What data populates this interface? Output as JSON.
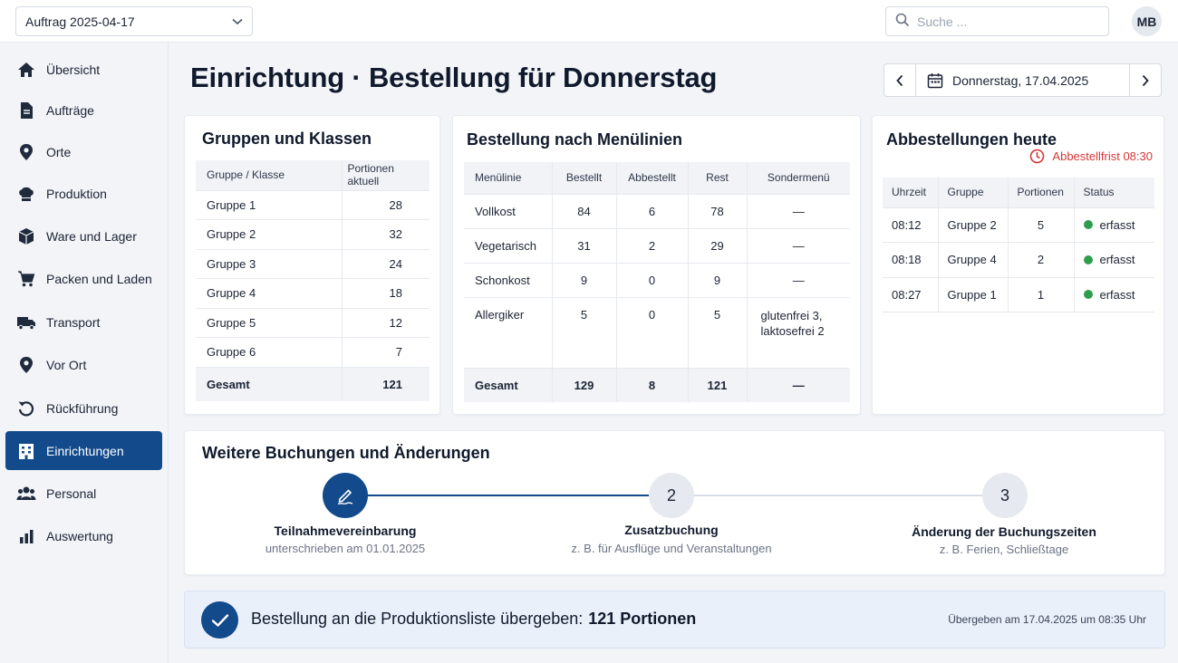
{
  "topbar": {
    "order_select_value": "Auftrag 2025-04-17",
    "search_placeholder": "Suche ...",
    "avatar_initials": "MB"
  },
  "sidebar": {
    "items": [
      {
        "label": "Übersicht",
        "icon": "home-icon"
      },
      {
        "label": "Aufträge",
        "icon": "document-icon"
      },
      {
        "label": "Orte",
        "icon": "location-pin-icon"
      },
      {
        "label": "Produktion",
        "icon": "chef-hat-icon"
      },
      {
        "label": "Ware und Lager",
        "icon": "box-icon"
      },
      {
        "label": "Packen und Laden",
        "icon": "cart-icon"
      },
      {
        "label": "Transport",
        "icon": "truck-icon"
      },
      {
        "label": "Vor Ort",
        "icon": "location-pin-icon"
      },
      {
        "label": "Rückführung",
        "icon": "return-arrow-icon"
      },
      {
        "label": "Einrichtungen",
        "icon": "building-icon",
        "active": true
      },
      {
        "label": "Personal",
        "icon": "people-icon"
      },
      {
        "label": "Auswertung",
        "icon": "bar-chart-icon"
      }
    ]
  },
  "header": {
    "title": "Einrichtung · Bestellung für Donnerstag",
    "date": "Donnerstag, 17.04.2025"
  },
  "groups": {
    "title": "Gruppen und Klassen",
    "columns": [
      "Gruppe / Klasse",
      "Portionen aktuell"
    ],
    "rows": [
      {
        "name": "Gruppe 1",
        "portions": "28"
      },
      {
        "name": "Gruppe 2",
        "portions": "32"
      },
      {
        "name": "Gruppe 3",
        "portions": "24"
      },
      {
        "name": "Gruppe 4",
        "portions": "18"
      },
      {
        "name": "Gruppe 5",
        "portions": "12"
      },
      {
        "name": "Gruppe 6",
        "portions": "7"
      }
    ],
    "total": {
      "label": "Gesamt",
      "portions": "121"
    }
  },
  "menu": {
    "title": "Bestellung nach Menülinien",
    "columns": [
      "Menülinie",
      "Bestellt",
      "Abbestellt",
      "Rest",
      "Sondermenü"
    ],
    "rows": [
      {
        "line": "Vollkost",
        "ordered": "84",
        "cancelled": "6",
        "rest": "78",
        "special": "—"
      },
      {
        "line": "Vegetarisch",
        "ordered": "31",
        "cancelled": "2",
        "rest": "29",
        "special": "—"
      },
      {
        "line": "Schonkost",
        "ordered": "9",
        "cancelled": "0",
        "rest": "9",
        "special": "—"
      },
      {
        "line": "Allergiker",
        "ordered": "5",
        "cancelled": "0",
        "rest": "5",
        "special_line1": "glutenfrei 3,",
        "special_line2": "laktosefrei 2"
      }
    ],
    "total": {
      "label": "Gesamt",
      "ordered": "129",
      "cancelled": "8",
      "rest": "121",
      "special": "—"
    }
  },
  "cancellations": {
    "title": "Abbestellungen heute",
    "deadline": "Abbestellfrist 08:30",
    "columns": [
      "Uhrzeit",
      "Gruppe",
      "Portionen",
      "Status"
    ],
    "rows": [
      {
        "time": "08:12",
        "group": "Gruppe 2",
        "portions": "5",
        "status": "erfasst"
      },
      {
        "time": "08:18",
        "group": "Gruppe 4",
        "portions": "2",
        "status": "erfasst"
      },
      {
        "time": "08:27",
        "group": "Gruppe 1",
        "portions": "1",
        "status": "erfasst"
      }
    ]
  },
  "bookings": {
    "title": "Weitere Buchungen und Änderungen",
    "steps": [
      {
        "number": "",
        "icon": "pen-signature-icon",
        "label": "Teilnahmevereinbarung",
        "sub": "unterschrieben am 01.01.2025",
        "state": "done"
      },
      {
        "number": "2",
        "label": "Zusatzbuchung",
        "sub": "z. B. für Ausflüge und Veranstaltungen",
        "state": "open"
      },
      {
        "number": "3",
        "label": "Änderung der Buchungszeiten",
        "sub": "z. B. Ferien, Schließtage",
        "state": "open"
      }
    ]
  },
  "banner": {
    "message": "Bestellung an die Produktionsliste übergeben:",
    "value": "121 Portionen",
    "timestamp": "Übergeben am 17.04.2025 um 08:35 Uhr"
  },
  "colors": {
    "primary": "#124a8c",
    "deadline_red": "#d63838",
    "status_green": "#2e9e4e"
  }
}
